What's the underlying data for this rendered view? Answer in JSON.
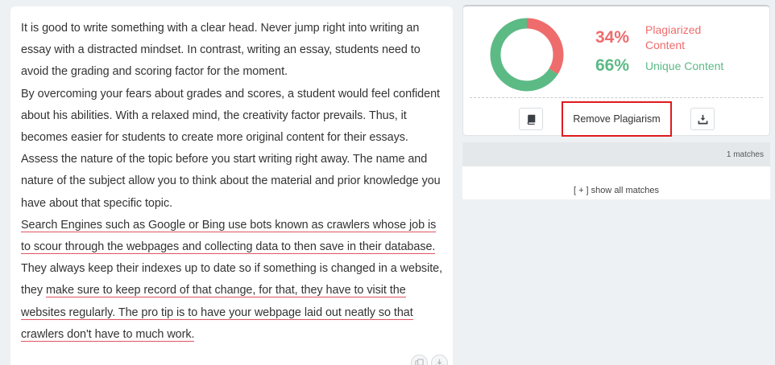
{
  "essay": {
    "paragraphs": [
      [
        {
          "text": "It is good to write something with a clear head. Never jump right into writing an essay with a distracted mindset. In contrast, writing an essay, students need to avoid the grading and scoring factor for the moment.",
          "match": false
        }
      ],
      [
        {
          "text": "By overcoming your fears about grades and scores, a student would feel confident about his abilities. With a relaxed mind, the creativity factor prevails. Thus, it becomes easier for students to create more original content for their essays.",
          "match": false
        }
      ],
      [
        {
          "text": "Assess the nature of the topic before you start writing right away. The name and nature of the subject allow you to think about the material and prior knowledge you have about that specific topic.",
          "match": false
        }
      ],
      [
        {
          "text": "Search Engines such as Google or Bing use bots known as crawlers whose job is to scour through the webpages and collecting data to then save in their database.",
          "match": true
        },
        {
          "text": " They always keep their indexes up to date so if something is changed in a website, they ",
          "match": false
        },
        {
          "text": "make sure to keep record of that change, for that, they have to visit the websites regularly.  The pro tip is to have your webpage laid out neatly so that crawlers don't have to much work.",
          "match": true
        }
      ]
    ],
    "tools": [
      {
        "name": "copy-icon"
      },
      {
        "name": "download-icon"
      }
    ]
  },
  "result": {
    "plagiarized_percent": "34%",
    "plagiarized_label": "Plagiarized Content",
    "unique_percent": "66%",
    "unique_label": "Unique Content",
    "plagiarized_fraction": 0.34,
    "unique_fraction": 0.66,
    "colors": {
      "plagiarized": "#ee6c6c",
      "unique": "#5cba85"
    },
    "book_icon": "book-icon",
    "remove_button_label": "Remove Plagiarism",
    "download_icon": "download-icon"
  },
  "matches": {
    "count_label": "1 matches",
    "show_all_label": "[ + ] show all matches"
  }
}
